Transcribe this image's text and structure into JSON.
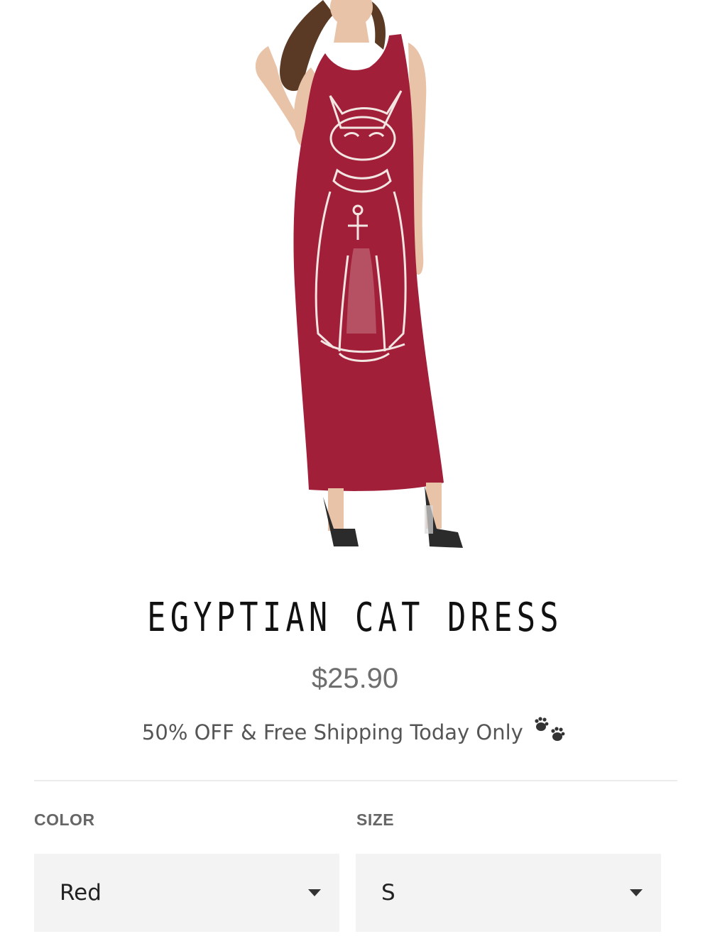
{
  "product": {
    "title": "EGYPTIAN CAT DRESS",
    "price": "$25.90",
    "promo": "50% OFF & Free Shipping Today Only",
    "promo_icon": "paw-prints-icon"
  },
  "options": {
    "color": {
      "label": "COLOR",
      "value": "Red"
    },
    "size": {
      "label": "SIZE",
      "value": "S"
    }
  },
  "colors": {
    "dress": "#a21f3a",
    "title": "#111111",
    "price": "#6e6e6e",
    "select_bg": "#f3f3f3"
  }
}
